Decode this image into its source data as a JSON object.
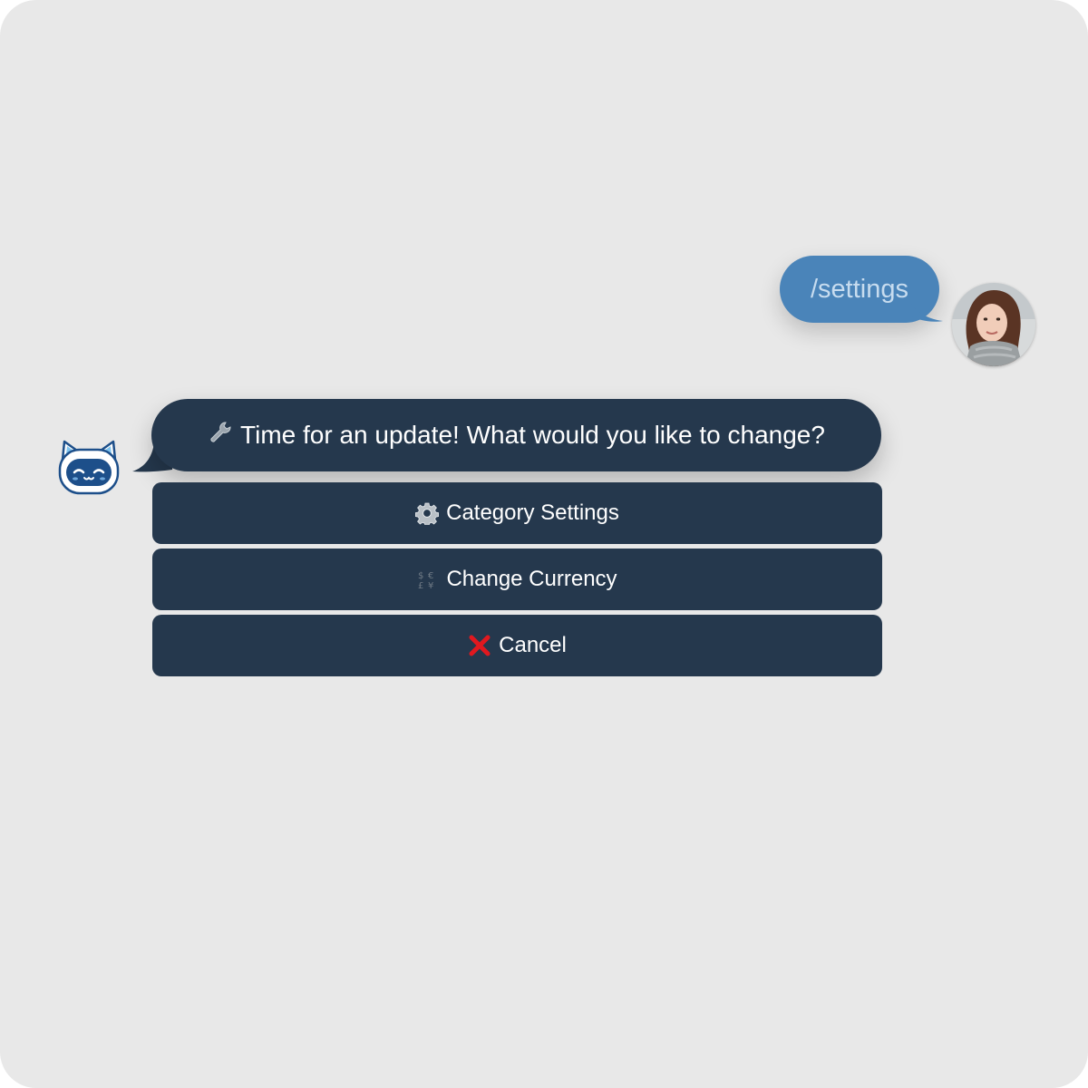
{
  "user_message": {
    "text": "/settings"
  },
  "bot_message": {
    "text": "Time for an update! What would you like to change?",
    "icon": "wrench-icon"
  },
  "keyboard": {
    "buttons": [
      {
        "label": "Category Settings",
        "icon": "gear-icon"
      },
      {
        "label": "Change Currency",
        "icon": "currency-exchange-icon"
      },
      {
        "label": "Cancel",
        "icon": "red-x-icon"
      }
    ]
  },
  "colors": {
    "background": "#e8e8e8",
    "user_bubble": "#4a84b9",
    "user_text": "#c7dcef",
    "bot_bubble": "#25384d",
    "button": "#25384d",
    "cancel_icon": "#e0181f"
  }
}
